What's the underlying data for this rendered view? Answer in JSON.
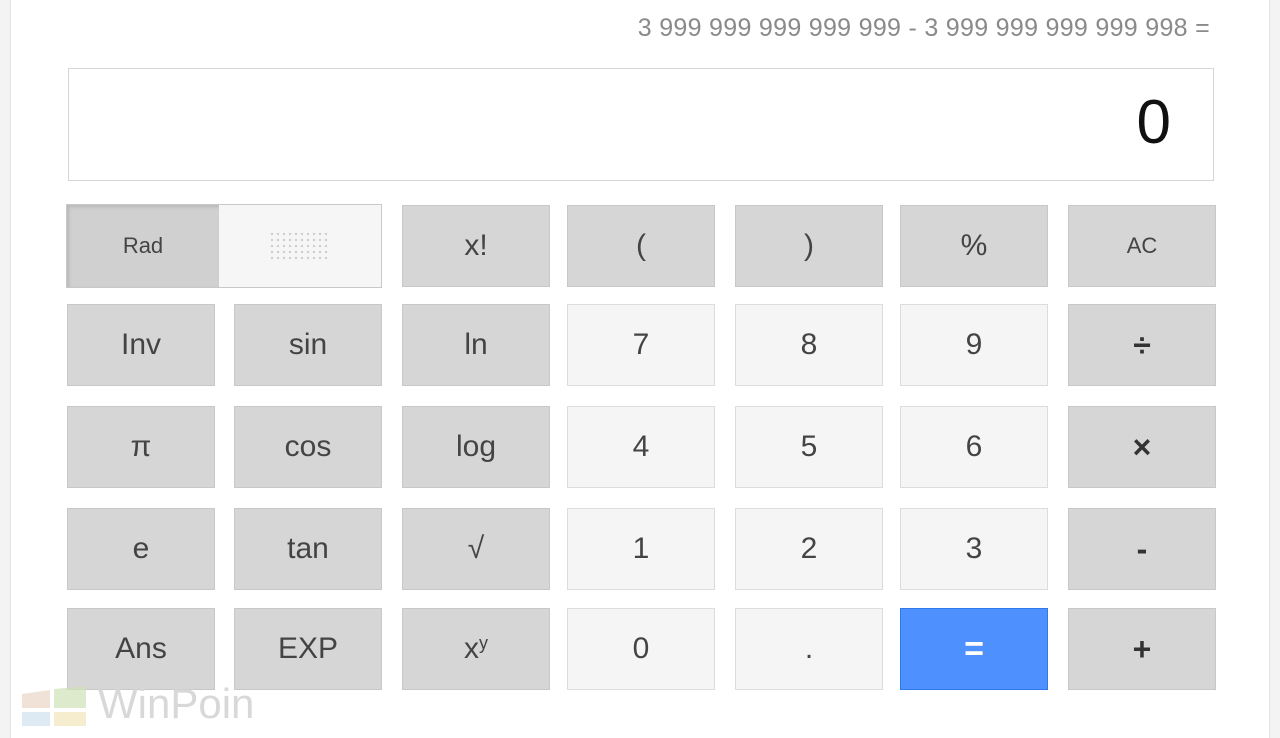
{
  "expression": "3 999 999 999 999 999 - 3 999 999 999 999 998 =",
  "display_value": "0",
  "angle_mode": {
    "rad_label": "Rad",
    "active": "Rad"
  },
  "keys": {
    "fact": "x!",
    "lparen": "(",
    "rparen": ")",
    "percent": "%",
    "ac": "AC",
    "inv": "Inv",
    "sin": "sin",
    "ln": "ln",
    "k7": "7",
    "k8": "8",
    "k9": "9",
    "divide": "÷",
    "pi": "π",
    "cos": "cos",
    "log": "log",
    "k4": "4",
    "k5": "5",
    "k6": "6",
    "multiply": "×",
    "e": "e",
    "tan": "tan",
    "sqrt": "√",
    "k1": "1",
    "k2": "2",
    "k3": "3",
    "minus": "-",
    "ans": "Ans",
    "exp": "EXP",
    "pow_base": "x",
    "pow_exp": "y",
    "k0": "0",
    "dot": ".",
    "equals": "=",
    "plus": "+"
  },
  "colors": {
    "equals_button": "#4d90fe",
    "function_key": "#d6d6d6",
    "digit_key": "#f5f5f5"
  },
  "watermark": {
    "text": "WinPoin"
  }
}
